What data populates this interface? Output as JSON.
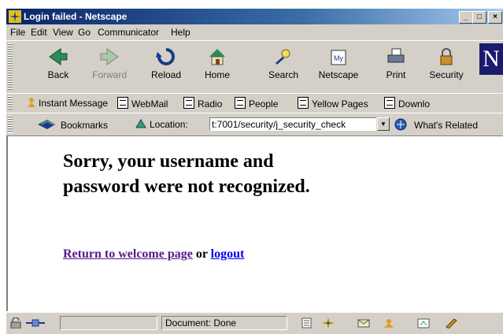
{
  "window": {
    "title": "Login failed - Netscape",
    "controls": [
      "_",
      "□",
      "×"
    ]
  },
  "menu": [
    "File",
    "Edit",
    "View",
    "Go",
    "Communicator",
    "Help"
  ],
  "navigation": {
    "buttons": [
      {
        "label": "Back",
        "icon": "back-arrow-icon",
        "enabled": true
      },
      {
        "label": "Forward",
        "icon": "forward-arrow-icon",
        "enabled": false
      },
      {
        "label": "Reload",
        "icon": "reload-icon",
        "enabled": true
      },
      {
        "label": "Home",
        "icon": "home-icon",
        "enabled": true
      },
      {
        "label": "Search",
        "icon": "search-icon",
        "enabled": true
      },
      {
        "label": "Netscape",
        "icon": "netscape-icon",
        "enabled": true
      },
      {
        "label": "Print",
        "icon": "print-icon",
        "enabled": true
      },
      {
        "label": "Security",
        "icon": "lock-icon",
        "enabled": true
      }
    ],
    "logo_letter": "N"
  },
  "personal_toolbar": [
    "Instant Message",
    "WebMail",
    "Radio",
    "People",
    "Yellow Pages",
    "Downlo"
  ],
  "location_bar": {
    "bookmarks_label": "Bookmarks",
    "location_label": "Location:",
    "url": "t:7001/security/j_security_check",
    "related_label": "What's Related"
  },
  "page": {
    "heading": "Sorry, your username and password were not recognized.",
    "link_welcome": "Return to welcome page",
    "connector": "or",
    "link_logout": "logout"
  },
  "status": {
    "text": "Document: Done"
  },
  "colors": {
    "title_bar": "#0a246a",
    "chrome": "#d4d0c8",
    "visited_link": "#551a8b",
    "link": "#0000ee"
  }
}
